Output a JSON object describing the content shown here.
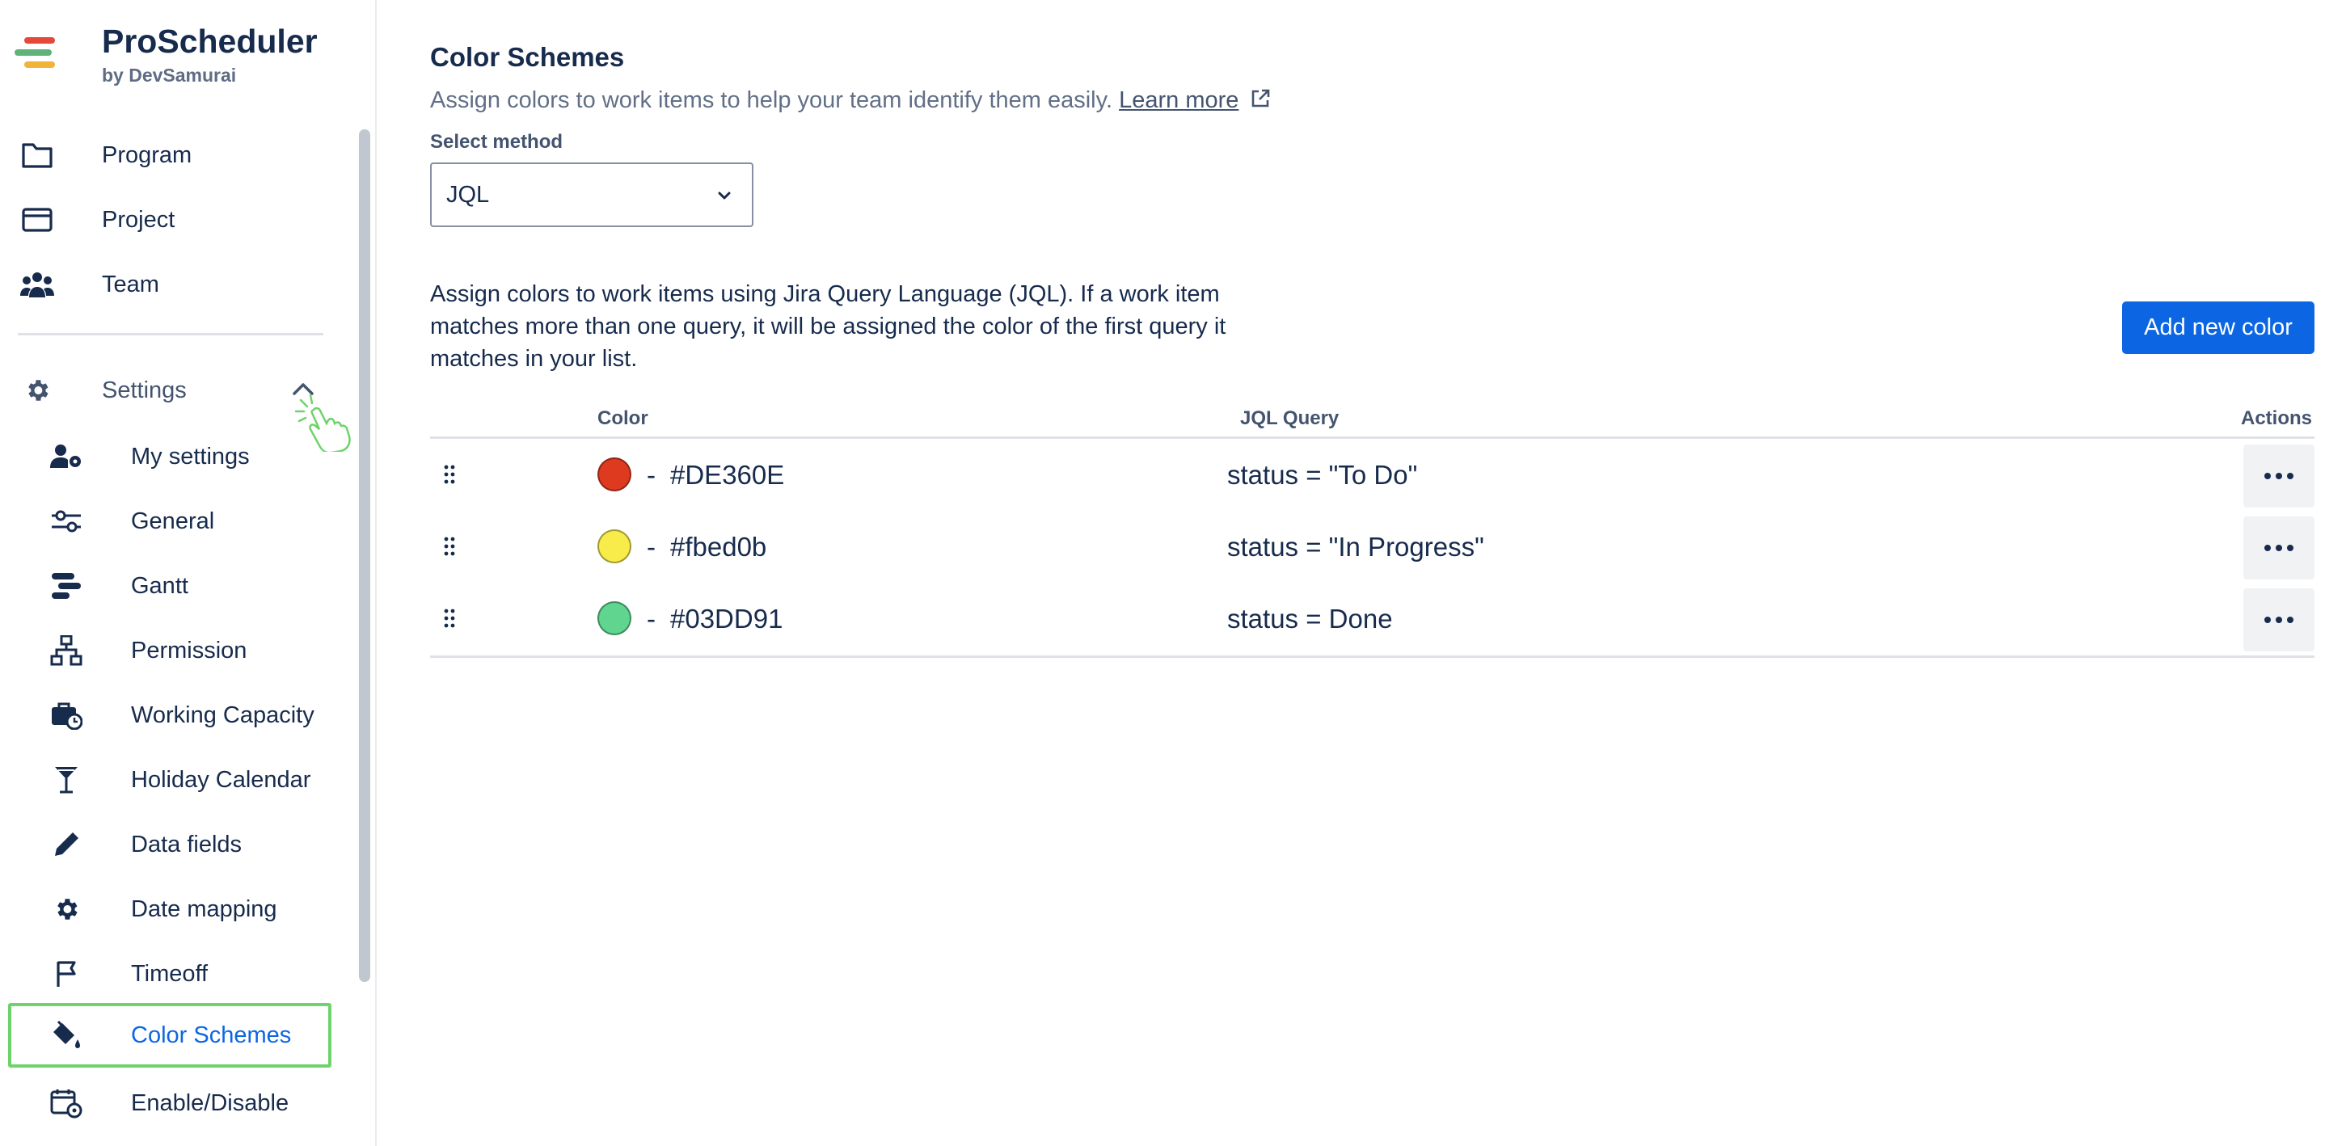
{
  "app": {
    "name": "ProScheduler",
    "subtitle": "by DevSamurai"
  },
  "sidebar": {
    "items": [
      {
        "label": "Program",
        "icon": "folder-icon"
      },
      {
        "label": "Project",
        "icon": "card-icon"
      },
      {
        "label": "Team",
        "icon": "people-icon"
      }
    ],
    "settings": {
      "label": "Settings",
      "icon": "gear-icon",
      "expanded": true
    },
    "sub_items": [
      {
        "label": "My settings",
        "icon": "user-gear-icon"
      },
      {
        "label": "General",
        "icon": "sliders-icon"
      },
      {
        "label": "Gantt",
        "icon": "gantt-icon"
      },
      {
        "label": "Permission",
        "icon": "hierarchy-icon"
      },
      {
        "label": "Working Capacity",
        "icon": "briefcase-clock-icon"
      },
      {
        "label": "Holiday Calendar",
        "icon": "cocktail-icon"
      },
      {
        "label": "Data fields",
        "icon": "pencil-icon"
      },
      {
        "label": "Date mapping",
        "icon": "gear-icon"
      },
      {
        "label": "Timeoff",
        "icon": "flag-icon"
      },
      {
        "label": "Color Schemes",
        "icon": "paint-bucket-icon",
        "active": true
      },
      {
        "label": "Enable/Disable",
        "icon": "calendar-gear-icon"
      }
    ]
  },
  "main": {
    "title": "Color Schemes",
    "description": "Assign colors to work items to help your team identify them easily.",
    "learn_more": "Learn more",
    "select_label": "Select method",
    "select_value": "JQL",
    "paragraph": "Assign colors to work items using Jira Query Language (JQL). If a work item matches more than one query, it will be assigned the color of the first query it matches in your list.",
    "add_button": "Add new color",
    "table": {
      "headers": {
        "color": "Color",
        "query": "JQL Query",
        "actions": "Actions"
      },
      "rows": [
        {
          "dash": "-",
          "color": "#DE360E",
          "query": "status = \"To Do\""
        },
        {
          "dash": "-",
          "color": "#fbed0b",
          "query": "status = \"In Progress\""
        },
        {
          "dash": "-",
          "color": "#03DD91",
          "query": "status = Done"
        }
      ]
    }
  },
  "colors": {
    "accent": "#0c66e4",
    "active_outline": "#6fd36b",
    "swatch_fill": [
      "#de3a20",
      "#f7ec4a",
      "#5fd58f"
    ]
  }
}
